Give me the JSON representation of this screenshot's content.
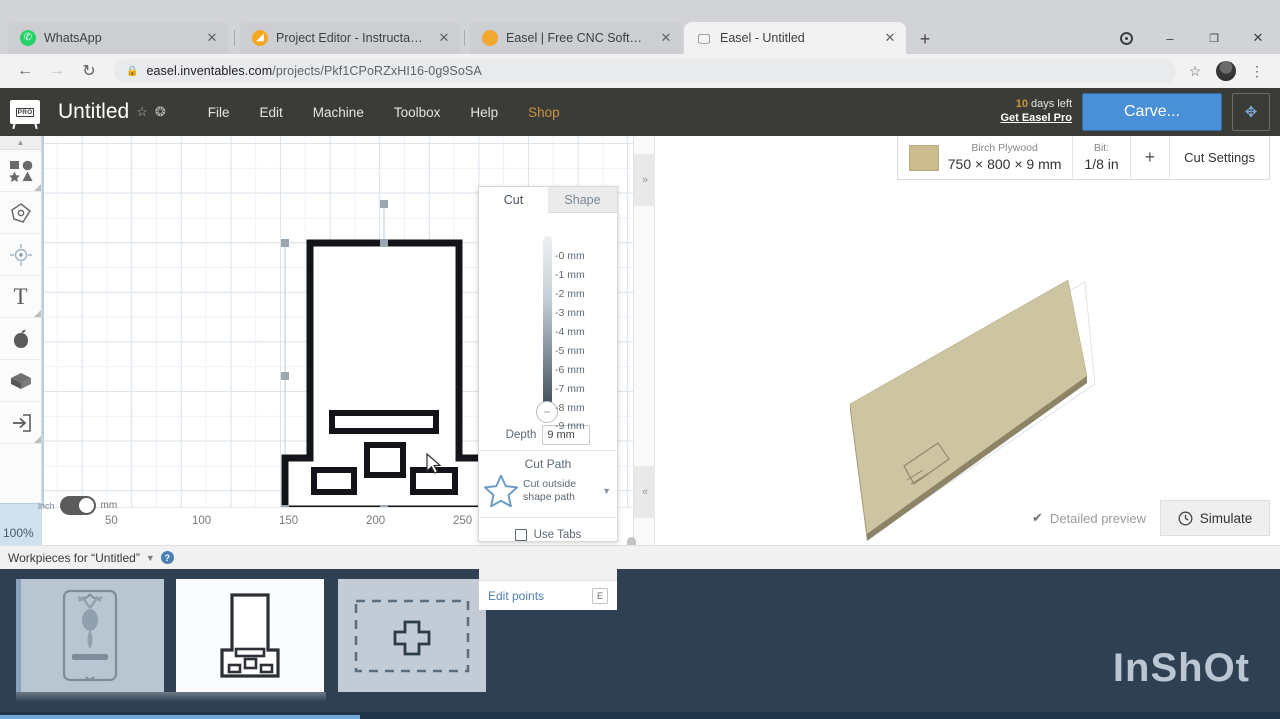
{
  "browser": {
    "tabs": [
      {
        "title": "WhatsApp",
        "favicon": "whatsapp-icon",
        "favicon_color": "#25d366",
        "active": false
      },
      {
        "title": "Project Editor - Instructables",
        "favicon": "instructables-icon",
        "favicon_color": "#f5a623",
        "active": false
      },
      {
        "title": "Easel | Free CNC Software | Inven",
        "favicon": "easel-icon",
        "favicon_color": "#f0a830",
        "active": false
      },
      {
        "title": "Easel - Untitled",
        "favicon": "easel-window-icon",
        "favicon_color": "#9aa0a6",
        "active": true
      }
    ],
    "new_tab_label": "+",
    "close_label": "✕",
    "window_controls": {
      "profile": "record-dot-icon",
      "minimize": "–",
      "maximize": "❐",
      "close": "✕"
    },
    "nav": {
      "back": "←",
      "forward": "→",
      "reload": "↻"
    },
    "url_secure_prefix": "easel.inventables.com",
    "url_path": "/projects/Pkf1CPoRZxHI16-0g9SoSA",
    "lock_icon": "lock-icon",
    "bookmark_icon": "star-outline-icon",
    "menu_icon": "kebab-menu-icon"
  },
  "app_header": {
    "logo_badge": "PRO",
    "project_title": "Untitled",
    "star_icon": "☆",
    "share_icon": "❂",
    "menu": [
      {
        "label": "File"
      },
      {
        "label": "Edit"
      },
      {
        "label": "Machine"
      },
      {
        "label": "Toolbox"
      },
      {
        "label": "Help"
      },
      {
        "label": "Shop",
        "accent": true
      }
    ],
    "trial_days": "10",
    "trial_text": "days left",
    "get_pro": "Get Easel Pro",
    "carve_label": "Carve...",
    "fit_icon": "fit-to-screen-icon",
    "accent_color": "#c9953f",
    "carve_color": "#4a90d9"
  },
  "left_toolbar": {
    "collapse_icon": "chevron-up-icon",
    "tools": [
      {
        "name": "shapes-tool",
        "icon": "shapes-icon"
      },
      {
        "name": "pen-tool",
        "icon": "pen-icon"
      },
      {
        "name": "origin-tool",
        "icon": "crosshair-icon"
      },
      {
        "name": "text-tool",
        "icon": "text-T-icon"
      },
      {
        "name": "apps-tool",
        "icon": "apple-icon"
      },
      {
        "name": "3d-tool",
        "icon": "cube-icon"
      },
      {
        "name": "import-tool",
        "icon": "import-arrow-icon"
      }
    ],
    "zoom_level": "100%"
  },
  "canvas": {
    "unit_inch_label": "inch",
    "unit_mm_label": "mm",
    "unit_selected": "mm",
    "ruler_ticks": [
      "50",
      "100",
      "150",
      "200",
      "250"
    ],
    "cursor_icon": "arrow-cursor-icon"
  },
  "cut_panel": {
    "tabs": [
      {
        "label": "Cut",
        "active": true
      },
      {
        "label": "Shape",
        "active": false
      }
    ],
    "depth_ticks": [
      "-0 mm",
      "-1 mm",
      "-2 mm",
      "-3 mm",
      "-4 mm",
      "-5 mm",
      "-6 mm",
      "-7 mm",
      "-8 mm",
      "-9 mm"
    ],
    "slider_handle_icon": "minus-handle-icon",
    "depth_label": "Depth",
    "depth_value": "9 mm",
    "cut_path_title": "Cut Path",
    "cut_path_value": "Cut outside shape path",
    "cut_path_icon": "star-outline-icon",
    "dropdown_icon": "caret-down-icon",
    "use_tabs_label": "Use Tabs",
    "use_tabs_checked": false,
    "edit_points_label": "Edit points",
    "edit_points_shortcut": "E"
  },
  "divider": {
    "expand_icon": "»",
    "grip_icon": "⋯",
    "collapse_icon": "«"
  },
  "preview": {
    "material_name": "Birch Plywood",
    "material_dims": "750 × 800 × 9 mm",
    "bit_label": "Bit:",
    "bit_value": "1/8 in",
    "add_icon": "plus-icon",
    "cut_settings_label": "Cut Settings",
    "material_swatch_color": "#cbbd8f",
    "detailed_preview_label": "Detailed preview",
    "detailed_check_icon": "check-icon",
    "simulate_label": "Simulate",
    "simulate_icon": "clock-icon"
  },
  "workpieces": {
    "header": "Workpieces for “Untitled”",
    "caret_icon": "caret-down-icon",
    "help_icon": "question-mark-icon",
    "items": [
      {
        "name": "workpiece-thumb-deer",
        "selected": false
      },
      {
        "name": "workpiece-thumb-stand",
        "selected": true
      },
      {
        "name": "workpiece-add-new",
        "selected": false,
        "icon": "plus-icon"
      }
    ]
  },
  "watermark": {
    "text": "InShOt"
  }
}
